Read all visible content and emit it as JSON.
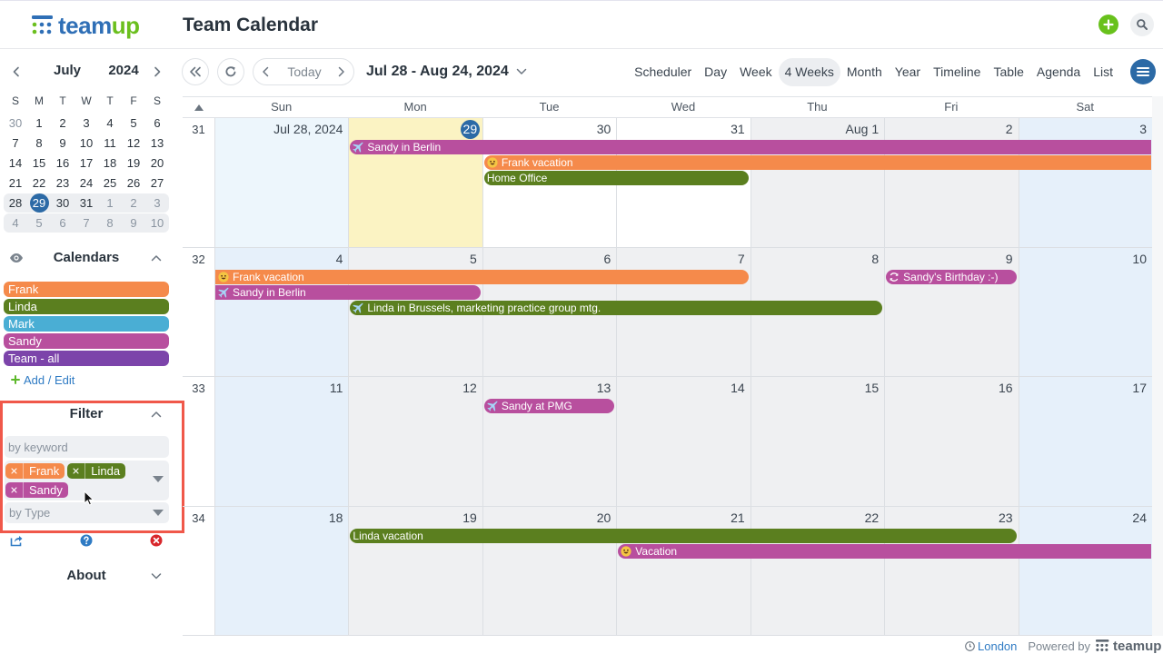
{
  "app": {
    "logo": {
      "part1": "team",
      "part2": "up"
    },
    "title": "Team Calendar"
  },
  "mini_calendar": {
    "month": "July",
    "year": "2024",
    "weekdays": [
      "S",
      "M",
      "T",
      "W",
      "T",
      "F",
      "S"
    ],
    "weeks": [
      {
        "in_range": false,
        "days": [
          {
            "d": "30",
            "muted": true
          },
          {
            "d": "1"
          },
          {
            "d": "2"
          },
          {
            "d": "3"
          },
          {
            "d": "4"
          },
          {
            "d": "5"
          },
          {
            "d": "6"
          }
        ]
      },
      {
        "in_range": false,
        "days": [
          {
            "d": "7"
          },
          {
            "d": "8"
          },
          {
            "d": "9"
          },
          {
            "d": "10"
          },
          {
            "d": "11"
          },
          {
            "d": "12"
          },
          {
            "d": "13"
          }
        ]
      },
      {
        "in_range": false,
        "days": [
          {
            "d": "14"
          },
          {
            "d": "15"
          },
          {
            "d": "16"
          },
          {
            "d": "17"
          },
          {
            "d": "18"
          },
          {
            "d": "19"
          },
          {
            "d": "20"
          }
        ]
      },
      {
        "in_range": false,
        "days": [
          {
            "d": "21"
          },
          {
            "d": "22"
          },
          {
            "d": "23"
          },
          {
            "d": "24"
          },
          {
            "d": "25"
          },
          {
            "d": "26"
          },
          {
            "d": "27"
          }
        ]
      },
      {
        "in_range": true,
        "days": [
          {
            "d": "28"
          },
          {
            "d": "29",
            "today": true
          },
          {
            "d": "30"
          },
          {
            "d": "31"
          },
          {
            "d": "1",
            "muted": true
          },
          {
            "d": "2",
            "muted": true
          },
          {
            "d": "3",
            "muted": true
          }
        ]
      },
      {
        "in_range": true,
        "days": [
          {
            "d": "4",
            "muted": true
          },
          {
            "d": "5",
            "muted": true
          },
          {
            "d": "6",
            "muted": true
          },
          {
            "d": "7",
            "muted": true
          },
          {
            "d": "8",
            "muted": true
          },
          {
            "d": "9",
            "muted": true
          },
          {
            "d": "10",
            "muted": true
          }
        ]
      }
    ]
  },
  "calendars": {
    "title": "Calendars",
    "items": [
      {
        "name": "Frank",
        "color": "#f58a4b"
      },
      {
        "name": "Linda",
        "color": "#5b7f1f"
      },
      {
        "name": "Mark",
        "color": "#4aaed4"
      },
      {
        "name": "Sandy",
        "color": "#b84f9e"
      },
      {
        "name": "Team - all",
        "color": "#7c44aa"
      }
    ],
    "add_edit": "Add / Edit"
  },
  "filter": {
    "title": "Filter",
    "keyword_placeholder": "by keyword",
    "keyword_value": "",
    "selected_calendars": [
      "Frank",
      "Linda",
      "Sandy"
    ],
    "type_placeholder": "by Type"
  },
  "about": {
    "title": "About"
  },
  "toolbar": {
    "today": "Today",
    "date_range": "Jul 28 - Aug 24, 2024",
    "views": [
      {
        "label": "Scheduler"
      },
      {
        "label": "Day"
      },
      {
        "label": "Week"
      },
      {
        "label": "4 Weeks",
        "active": true
      },
      {
        "label": "Month"
      },
      {
        "label": "Year"
      },
      {
        "label": "Timeline"
      },
      {
        "label": "Table"
      },
      {
        "label": "Agenda"
      },
      {
        "label": "List"
      }
    ]
  },
  "grid": {
    "weekdays": [
      "Sun",
      "Mon",
      "Tue",
      "Wed",
      "Thu",
      "Fri",
      "Sat"
    ],
    "weeks": [
      {
        "week": "31",
        "days": [
          {
            "label": "Jul 28, 2024",
            "kind": "weekend"
          },
          {
            "label": "29",
            "kind": "today"
          },
          {
            "label": "30",
            "kind": "current"
          },
          {
            "label": "31",
            "kind": "current"
          },
          {
            "label": "Aug 1",
            "kind": "other"
          },
          {
            "label": "2",
            "kind": "other"
          },
          {
            "label": "3",
            "kind": "weekend-other"
          }
        ],
        "events": [
          {
            "title": "Sandy in Berlin",
            "calendar": "Sandy",
            "icon": "airplane",
            "from": "Mon",
            "to": "Sat",
            "continues_before": false,
            "continues_after": true
          },
          {
            "title": "Frank vacation",
            "calendar": "Frank",
            "icon": "smiley",
            "from": "Tue",
            "to": "Sat",
            "continues_before": false,
            "continues_after": true
          },
          {
            "title": "Home Office",
            "calendar": "Linda",
            "icon": null,
            "from": "Tue",
            "to": "Wed",
            "continues_before": false,
            "continues_after": false
          }
        ]
      },
      {
        "week": "32",
        "days": [
          {
            "label": "4",
            "kind": "weekend-other"
          },
          {
            "label": "5",
            "kind": "other"
          },
          {
            "label": "6",
            "kind": "other"
          },
          {
            "label": "7",
            "kind": "other"
          },
          {
            "label": "8",
            "kind": "other"
          },
          {
            "label": "9",
            "kind": "other"
          },
          {
            "label": "10",
            "kind": "weekend-other"
          }
        ],
        "events": [
          {
            "title": "Frank vacation",
            "calendar": "Frank",
            "icon": "smiley",
            "from": "Sun",
            "to": "Wed",
            "continues_before": true,
            "continues_after": false
          },
          {
            "title": "Sandy's Birthday :-)",
            "calendar": "Sandy",
            "icon": "recurring",
            "from": "Fri",
            "to": "Fri",
            "continues_before": false,
            "continues_after": false
          },
          {
            "title": "Sandy in Berlin",
            "calendar": "Sandy",
            "icon": "airplane",
            "from": "Sun",
            "to": "Mon",
            "continues_before": true,
            "continues_after": false
          },
          {
            "title": "Linda in Brussels, marketing practice group mtg.",
            "calendar": "Linda",
            "icon": "airplane",
            "from": "Mon",
            "to": "Thu",
            "continues_before": false,
            "continues_after": false
          }
        ]
      },
      {
        "week": "33",
        "days": [
          {
            "label": "11",
            "kind": "weekend-other"
          },
          {
            "label": "12",
            "kind": "other"
          },
          {
            "label": "13",
            "kind": "other"
          },
          {
            "label": "14",
            "kind": "other"
          },
          {
            "label": "15",
            "kind": "other"
          },
          {
            "label": "16",
            "kind": "other"
          },
          {
            "label": "17",
            "kind": "weekend-other"
          }
        ],
        "events": [
          {
            "title": "Sandy at PMG",
            "calendar": "Sandy",
            "icon": "airplane",
            "from": "Tue",
            "to": "Tue",
            "continues_before": false,
            "continues_after": false
          }
        ]
      },
      {
        "week": "34",
        "days": [
          {
            "label": "18",
            "kind": "weekend-other"
          },
          {
            "label": "19",
            "kind": "other"
          },
          {
            "label": "20",
            "kind": "other"
          },
          {
            "label": "21",
            "kind": "other"
          },
          {
            "label": "22",
            "kind": "other"
          },
          {
            "label": "23",
            "kind": "other"
          },
          {
            "label": "24",
            "kind": "weekend-other"
          }
        ],
        "events": [
          {
            "title": "Linda vacation",
            "calendar": "Linda",
            "icon": null,
            "from": "Mon",
            "to": "Fri",
            "continues_before": false,
            "continues_after": false
          },
          {
            "title": "Vacation",
            "calendar": "Sandy",
            "icon": "smiley",
            "from": "Wed",
            "to": "Sat",
            "continues_before": false,
            "continues_after": true
          }
        ]
      }
    ]
  },
  "footer": {
    "timezone": "London",
    "powered_by": "Powered by",
    "logo": "teamup"
  }
}
